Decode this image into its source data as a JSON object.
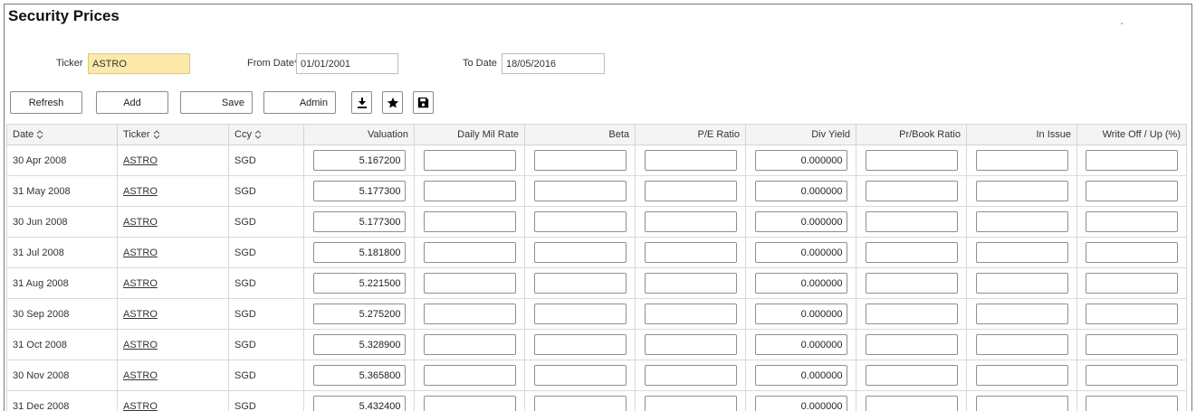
{
  "page": {
    "title": "Security Prices"
  },
  "filters": {
    "ticker_label": "Ticker",
    "ticker_value": "ASTRO",
    "from_label": "From Date*",
    "from_value": "01/01/2001",
    "to_label": "To Date",
    "to_value": "18/05/2016"
  },
  "toolbar": {
    "refresh": "Refresh",
    "add": "Add",
    "save": "Save",
    "admin": "Admin",
    "icons": [
      "download-icon",
      "star-icon",
      "floppy-disk-icon"
    ]
  },
  "table": {
    "headers": [
      "Date",
      "Ticker",
      "Ccy",
      "Valuation",
      "Daily Mil Rate",
      "Beta",
      "P/E Ratio",
      "Div Yield",
      "Pr/Book Ratio",
      "In Issue",
      "Write Off / Up (%)"
    ],
    "rows": [
      {
        "date": "30 Apr 2008",
        "ticker": "ASTRO",
        "ccy": "SGD",
        "valuation": "5.167200",
        "daily_mil_rate": "",
        "beta": "",
        "pe_ratio": "",
        "div_yield": "0.000000",
        "pr_book_ratio": "",
        "in_issue": "",
        "write_off": ""
      },
      {
        "date": "31 May 2008",
        "ticker": "ASTRO",
        "ccy": "SGD",
        "valuation": "5.177300",
        "daily_mil_rate": "",
        "beta": "",
        "pe_ratio": "",
        "div_yield": "0.000000",
        "pr_book_ratio": "",
        "in_issue": "",
        "write_off": ""
      },
      {
        "date": "30 Jun 2008",
        "ticker": "ASTRO",
        "ccy": "SGD",
        "valuation": "5.177300",
        "daily_mil_rate": "",
        "beta": "",
        "pe_ratio": "",
        "div_yield": "0.000000",
        "pr_book_ratio": "",
        "in_issue": "",
        "write_off": ""
      },
      {
        "date": "31 Jul 2008",
        "ticker": "ASTRO",
        "ccy": "SGD",
        "valuation": "5.181800",
        "daily_mil_rate": "",
        "beta": "",
        "pe_ratio": "",
        "div_yield": "0.000000",
        "pr_book_ratio": "",
        "in_issue": "",
        "write_off": ""
      },
      {
        "date": "31 Aug 2008",
        "ticker": "ASTRO",
        "ccy": "SGD",
        "valuation": "5.221500",
        "daily_mil_rate": "",
        "beta": "",
        "pe_ratio": "",
        "div_yield": "0.000000",
        "pr_book_ratio": "",
        "in_issue": "",
        "write_off": ""
      },
      {
        "date": "30 Sep 2008",
        "ticker": "ASTRO",
        "ccy": "SGD",
        "valuation": "5.275200",
        "daily_mil_rate": "",
        "beta": "",
        "pe_ratio": "",
        "div_yield": "0.000000",
        "pr_book_ratio": "",
        "in_issue": "",
        "write_off": ""
      },
      {
        "date": "31 Oct 2008",
        "ticker": "ASTRO",
        "ccy": "SGD",
        "valuation": "5.328900",
        "daily_mil_rate": "",
        "beta": "",
        "pe_ratio": "",
        "div_yield": "0.000000",
        "pr_book_ratio": "",
        "in_issue": "",
        "write_off": ""
      },
      {
        "date": "30 Nov 2008",
        "ticker": "ASTRO",
        "ccy": "SGD",
        "valuation": "5.365800",
        "daily_mil_rate": "",
        "beta": "",
        "pe_ratio": "",
        "div_yield": "0.000000",
        "pr_book_ratio": "",
        "in_issue": "",
        "write_off": ""
      },
      {
        "date": "31 Dec 2008",
        "ticker": "ASTRO",
        "ccy": "SGD",
        "valuation": "5.432400",
        "daily_mil_rate": "",
        "beta": "",
        "pe_ratio": "",
        "div_yield": "0.000000",
        "pr_book_ratio": "",
        "in_issue": "",
        "write_off": ""
      }
    ]
  }
}
